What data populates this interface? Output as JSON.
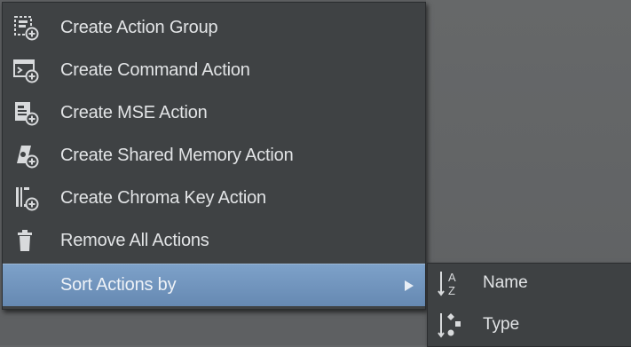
{
  "menu": {
    "items": [
      {
        "label": "Create Action Group",
        "icon": "action-group-add-icon"
      },
      {
        "label": "Create Command Action",
        "icon": "command-action-add-icon"
      },
      {
        "label": "Create MSE Action",
        "icon": "mse-action-add-icon"
      },
      {
        "label": "Create Shared Memory Action",
        "icon": "shared-memory-action-add-icon"
      },
      {
        "label": "Create Chroma Key Action",
        "icon": "chroma-key-action-add-icon"
      },
      {
        "label": "Remove All Actions",
        "icon": "trash-icon"
      },
      {
        "label": "Sort Actions by",
        "icon": "",
        "highlighted": true,
        "has_submenu": true
      }
    ]
  },
  "submenu": {
    "items": [
      {
        "label": "Name",
        "icon": "sort-az-icon"
      },
      {
        "label": "Type",
        "icon": "sort-type-icon"
      }
    ]
  }
}
